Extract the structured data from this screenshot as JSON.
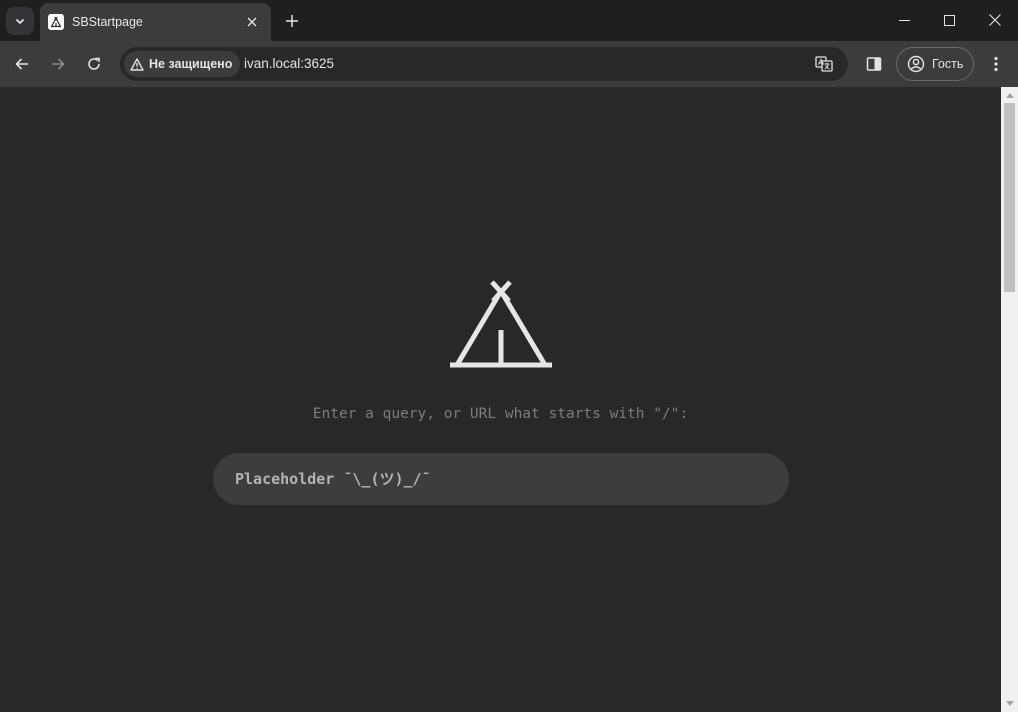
{
  "browser": {
    "tab": {
      "title": "SBStartpage"
    },
    "omnibox": {
      "security_label": "Не защищено",
      "url": "ivan.local:3625"
    },
    "profile": {
      "label": "Гость"
    }
  },
  "page": {
    "hint": "Enter a query, or URL what starts with \"/\":",
    "search": {
      "placeholder": "Placeholder ¯\\_(ツ)_/¯",
      "value": ""
    }
  },
  "colors": {
    "background": "#282828",
    "input_bg": "#3d3d3d",
    "hint": "#7d7d7d",
    "logo": "#e6e6e6"
  },
  "icons": [
    "tab-search-icon",
    "tent-icon",
    "close-icon",
    "plus-icon",
    "minimize-icon",
    "maximize-icon",
    "back-arrow-icon",
    "forward-arrow-icon",
    "reload-icon",
    "warning-icon",
    "translate-icon",
    "side-panel-icon",
    "person-icon",
    "kebab-menu-icon"
  ]
}
